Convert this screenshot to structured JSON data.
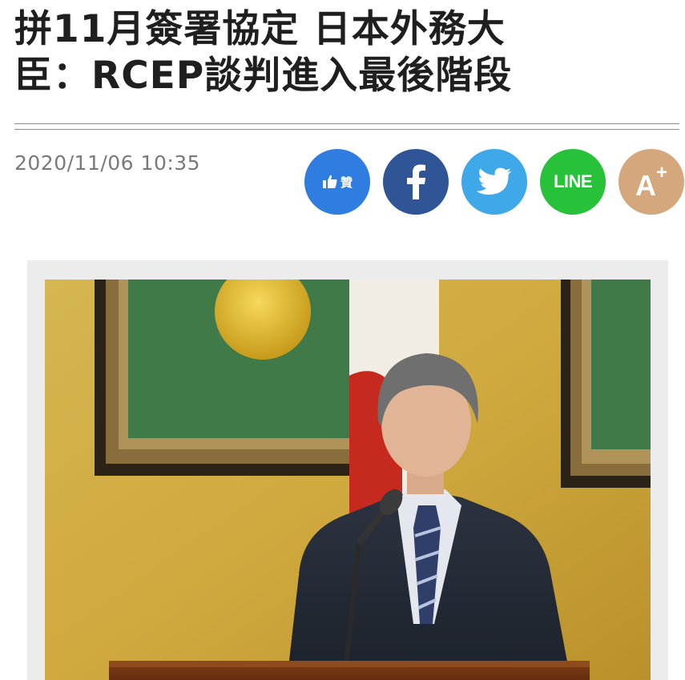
{
  "article": {
    "headline_line1": "拼11月簽署協定 日本外務大",
    "headline_line2": "臣：RCEP談判進入最後階段",
    "timestamp": "2020/11/06 10:35"
  },
  "share": {
    "like_label": "贊",
    "line_label": "LINE",
    "font_size_label": "A",
    "font_size_plus": "+",
    "buttons": [
      {
        "name": "like",
        "icon": "thumbs-up-icon",
        "color": "#2f7de0"
      },
      {
        "name": "facebook",
        "icon": "facebook-icon",
        "color": "#2f5597"
      },
      {
        "name": "twitter",
        "icon": "twitter-icon",
        "color": "#3ea8e8"
      },
      {
        "name": "line",
        "icon": "line-icon",
        "color": "#27c13a"
      },
      {
        "name": "font-size",
        "icon": "font-size-icon",
        "color": "#d4a77c"
      }
    ]
  },
  "photo": {
    "subject": "speaker-at-podium-photo"
  }
}
